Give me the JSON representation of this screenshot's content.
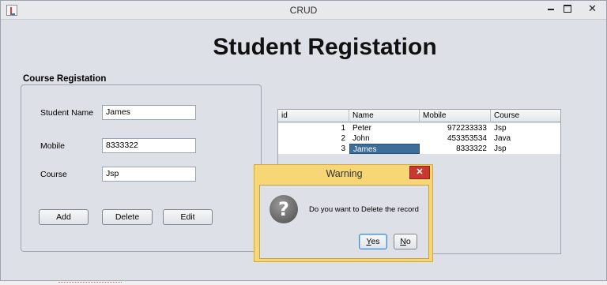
{
  "window": {
    "title": "CRUD",
    "close_glyph": "✕"
  },
  "heading": "Student Registation",
  "form": {
    "group_title": "Course Registation",
    "fields": [
      {
        "label": "Student Name",
        "value": "James"
      },
      {
        "label": "Mobile",
        "value": "8333322"
      },
      {
        "label": "Course",
        "value": "Jsp"
      }
    ],
    "buttons": {
      "add": "Add",
      "delete": "Delete",
      "edit": "Edit"
    }
  },
  "table": {
    "columns": [
      "id",
      "Name",
      "Mobile",
      "Course"
    ],
    "rows": [
      {
        "id": "1",
        "name": "Peter",
        "mobile": "972233333",
        "course": "Jsp"
      },
      {
        "id": "2",
        "name": "John",
        "mobile": "453353534",
        "course": "Java"
      },
      {
        "id": "3",
        "name": "James",
        "mobile": "8333322",
        "course": "Jsp"
      }
    ],
    "selected_row": 3
  },
  "dialog": {
    "title": "Warning",
    "message": "Do you want to Delete the record",
    "close_glyph": "✕",
    "yes": {
      "first": "Y",
      "rest": "es"
    },
    "no": {
      "first": "N",
      "rest": "o"
    },
    "icon": "question-icon"
  },
  "colors": {
    "window_bg": "#dde0e6",
    "selection": "#3d6e9a",
    "dialog_frame": "#f7d676",
    "dialog_close": "#c7392e"
  }
}
